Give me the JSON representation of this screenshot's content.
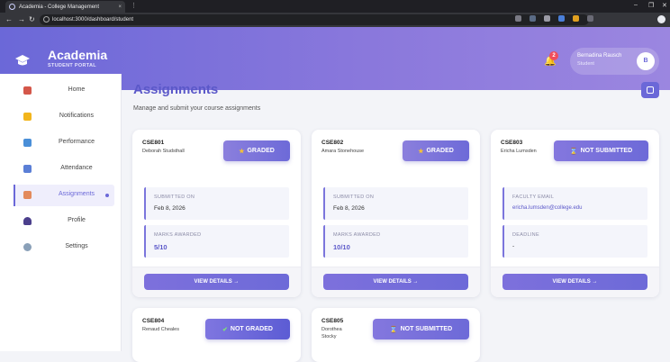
{
  "browser": {
    "tab_title": "Academia - College Management",
    "tab_close": "×",
    "url": "localhost:3000/dashboard/student",
    "win_min": "–",
    "win_restore": "❐",
    "win_close": "✕"
  },
  "header": {
    "brand": "Academia",
    "brand_sub": "STUDENT PORTAL",
    "notification_count": "2",
    "user_name": "Bernadina Rausch",
    "user_role": "Student",
    "avatar_initial": "B"
  },
  "sidebar": {
    "items": [
      {
        "label": "Home",
        "icon": "home-icon",
        "color": "#d4574a"
      },
      {
        "label": "Notifications",
        "icon": "bell-icon",
        "color": "#f2b51c"
      },
      {
        "label": "Performance",
        "icon": "bar-chart-icon",
        "color": "#4a8fd8"
      },
      {
        "label": "Attendance",
        "icon": "calendar-icon",
        "color": "#5b7fd6"
      },
      {
        "label": "Assignments",
        "icon": "pencil-icon",
        "color": "#e38a5c"
      },
      {
        "label": "Profile",
        "icon": "user-icon",
        "color": "#4b3f8c"
      },
      {
        "label": "Settings",
        "icon": "gear-icon",
        "color": "#8aa0b8"
      }
    ],
    "active_index": 4
  },
  "main": {
    "title": "Assignments",
    "subtitle": "Manage and submit your course assignments",
    "cards": [
      {
        "code": "CSE801",
        "faculty": "Deborah Studsthall",
        "status": "GRADED",
        "box1_label": "SUBMITTED ON",
        "box1_value": "Feb 8, 2026",
        "box2_label": "MARKS AWARDED",
        "box2_value": "5/10",
        "action": "VIEW DETAILS →"
      },
      {
        "code": "CSE802",
        "faculty": "Amara Stonehouse",
        "status": "GRADED",
        "box1_label": "SUBMITTED ON",
        "box1_value": "Feb 8, 2026",
        "box2_label": "MARKS AWARDED",
        "box2_value": "10/10",
        "action": "VIEW DETAILS →"
      },
      {
        "code": "CSE803",
        "faculty": "Ericha Lumsden",
        "status": "NOT SUBMITTED",
        "box1_label": "FACULTY EMAIL",
        "box1_value": "ericha.lumsden@college.edu",
        "box2_label": "DEADLINE",
        "box2_value": "-",
        "action": "VIEW DETAILS →"
      },
      {
        "code": "CSE804",
        "faculty": "Renaud Cheales",
        "status": "NOT GRADED"
      },
      {
        "code": "CSE805",
        "faculty": "Dorothea Stocky",
        "status": "NOT SUBMITTED"
      }
    ]
  }
}
